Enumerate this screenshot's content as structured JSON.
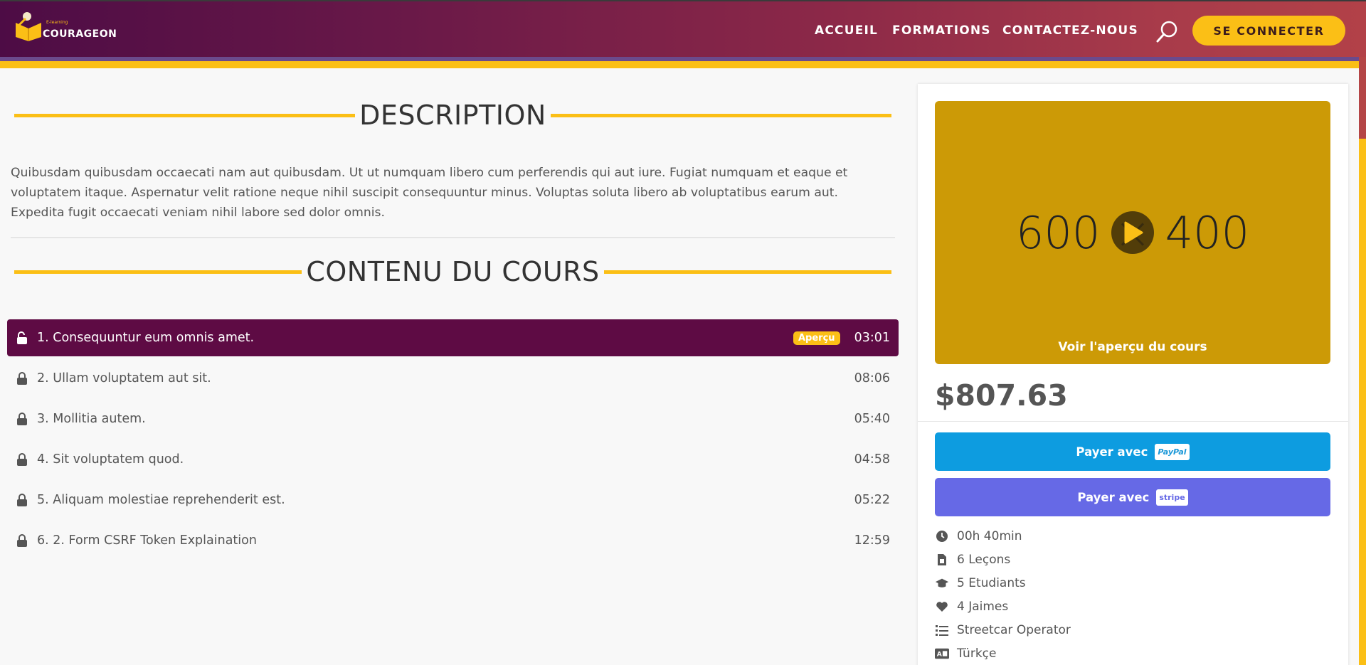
{
  "header": {
    "logo_text": "COURAGEON",
    "logo_sub": "E-learning",
    "nav": [
      "ACCUEIL",
      "FORMATIONS",
      "CONTACTEZ-NOUS"
    ],
    "login_label": "SE CONNECTER"
  },
  "main": {
    "description_title": "DESCRIPTION",
    "description_text": "Quibusdam quibusdam occaecati nam aut quibusdam. Ut ut numquam libero cum perferendis qui aut iure. Fugiat numquam et eaque et voluptatem itaque. Aspernatur velit ratione neque nihil suscipit consequuntur minus. Voluptas soluta libero ab voluptatibus earum aut. Expedita fugit occaecati veniam nihil labore sed dolor omnis.",
    "content_title": "CONTENU DU COURS",
    "lessons": [
      {
        "title": "1. Consequuntur eum omnis amet.",
        "duration": "03:01",
        "badge": "Aperçu",
        "locked": false,
        "active": true
      },
      {
        "title": "2. Ullam voluptatem aut sit.",
        "duration": "08:06",
        "locked": true
      },
      {
        "title": "3. Mollitia autem.",
        "duration": "05:40",
        "locked": true
      },
      {
        "title": "4. Sit voluptatem quod.",
        "duration": "04:58",
        "locked": true
      },
      {
        "title": "5. Aliquam molestiae reprehenderit est.",
        "duration": "05:22",
        "locked": true
      },
      {
        "title": "6. 2. Form CSRF Token Explaination",
        "duration": "12:59",
        "locked": true
      }
    ]
  },
  "sidebar": {
    "preview_placeholder": "600 × 400",
    "preview_caption": "Voir l'aperçu du cours",
    "price": "$807.63",
    "pay_paypal": "Payer avec",
    "paypal_logo": "PayPal",
    "pay_stripe": "Payer avec",
    "stripe_logo": "stripe",
    "meta": [
      {
        "icon": "clock-icon",
        "text": "00h 40min"
      },
      {
        "icon": "file-icon",
        "text": "6 Leçons"
      },
      {
        "icon": "graduation-cap-icon",
        "text": "5 Etudiants"
      },
      {
        "icon": "heart-icon",
        "text": "4 Jaimes"
      },
      {
        "icon": "list-icon",
        "text": "Streetcar Operator"
      },
      {
        "icon": "language-icon",
        "text": "Türkçe"
      }
    ]
  },
  "colors": {
    "accent_yellow": "#fbbf16",
    "active_lesson": "#5e0b44",
    "paypal_blue": "#0d9ce0",
    "stripe_purple": "#6669e6"
  }
}
